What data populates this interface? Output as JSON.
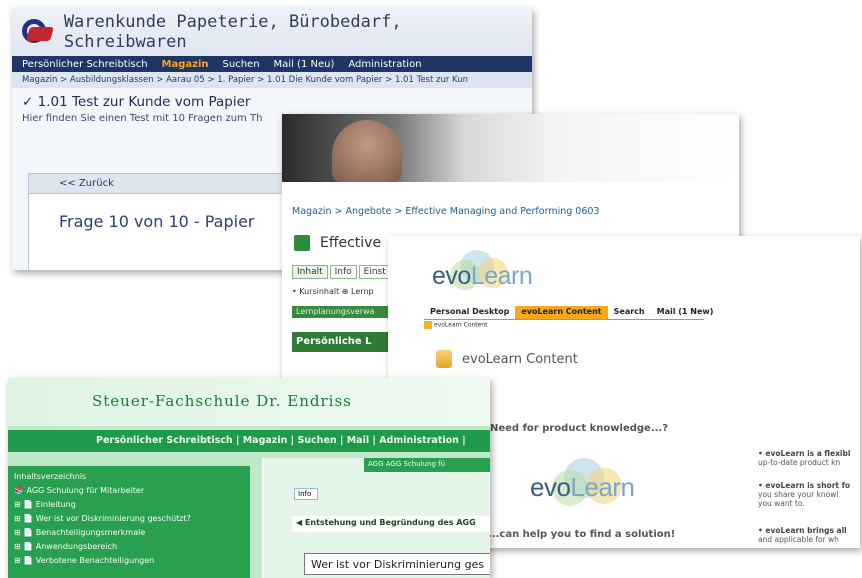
{
  "w1": {
    "title": "Warenkunde Papeterie, Bürobedarf, Schreibwaren",
    "nav": [
      "Persönlicher Schreibtisch",
      "Magazin",
      "Suchen",
      "Mail (1 Neu)",
      "Administration"
    ],
    "active_nav": "Magazin",
    "breadcrumb": "Magazin > Ausbildungsklassen > Aarau 05 > 1. Papier > 1.01 Die Kunde vom Papier > 1.01 Test zur Kun",
    "heading": "1.01 Test zur Kunde vom Papier",
    "subtext": "Hier finden Sie einen Test mit 10 Fragen zum Th",
    "back": "<< Zurück",
    "question": "Frage 10 von 10 - Papier"
  },
  "w2": {
    "breadcrumb": "Magazin > Angebote > Effective Managing and Performing 0603",
    "title": "Effective",
    "tabs": [
      "Inhalt",
      "Info",
      "Einst"
    ],
    "links": "• Kursinhalt  ⊕ Lernp",
    "bar": "Lernplanungsverwa",
    "bar2": "Persönliche L"
  },
  "w3": {
    "logo_a": "evo",
    "logo_b": "Learn",
    "nav": [
      "Personal Desktop",
      "evoLearn Content",
      "Search",
      "Mail (1 New)"
    ],
    "mini": "evoLearn Content",
    "content_title": "evoLearn Content",
    "need": "Need for product knowledge...?",
    "help": "...can help you to find a solution!",
    "bullets": [
      {
        "a": "• evoLearn is a flexibl",
        "b": "up-to-date product kn"
      },
      {
        "a": "• evoLearn is short fo",
        "b": "you share your knowl",
        "c": "you want to."
      },
      {
        "a": "• evoLearn brings all",
        "b": "and applicable for wh"
      }
    ]
  },
  "w4": {
    "header": "Steuer-Fachschule Dr. Endriss",
    "nav": "Persönlicher Schreibtisch | Magazin | Suchen | Mail | Administration |",
    "side_title": "Inhaltsverzeichnis",
    "side": [
      "AGG Schulung für Mitarbeiter",
      "Einleitung",
      "Wer ist vor Diskriminierung geschützt?",
      "Benachteiligungsmerkmale",
      "Anwendungsbereich",
      "Verbotene Benachteiligungen"
    ],
    "tab": "AGG  AGG Schulung fü",
    "info": "Info",
    "entstehung": "Entstehung und Begründung des AGG",
    "wer": "Wer ist vor Diskriminierung ges"
  }
}
